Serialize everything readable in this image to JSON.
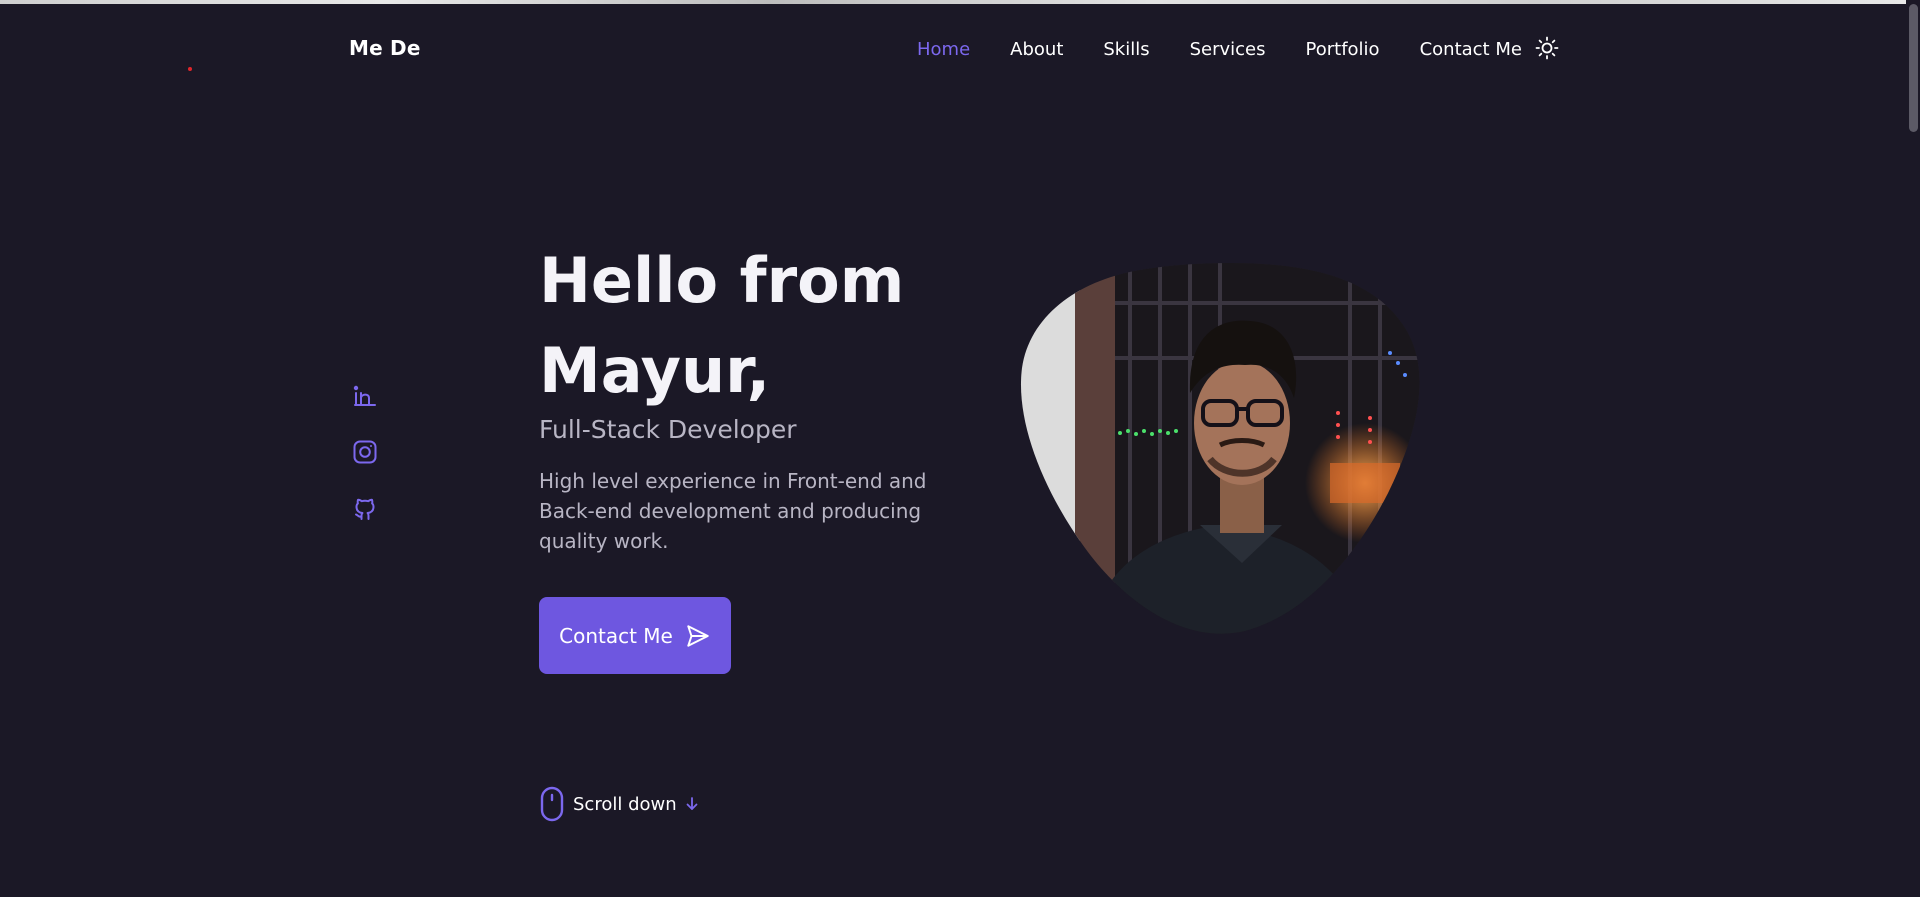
{
  "header": {
    "logo": "Me De",
    "nav": [
      {
        "label": "Home",
        "active": true
      },
      {
        "label": "About",
        "active": false
      },
      {
        "label": "Skills",
        "active": false
      },
      {
        "label": "Services",
        "active": false
      },
      {
        "label": "Portfolio",
        "active": false
      },
      {
        "label": "Contact Me",
        "active": false
      }
    ],
    "theme_toggle_icon": "sun-icon"
  },
  "socials": [
    {
      "icon": "linkedin-icon"
    },
    {
      "icon": "instagram-icon"
    },
    {
      "icon": "github-icon"
    }
  ],
  "hero": {
    "title_line1": "Hello from",
    "title_line2": "Mayur,",
    "subtitle": "Full-Stack Developer",
    "description": "High level experience in Front-end and Back-end development and producing quality work.",
    "cta_label": "Contact Me",
    "cta_icon": "send-icon"
  },
  "scroll": {
    "label": "Scroll down",
    "icon": "mouse-icon",
    "arrow_icon": "arrow-down-icon"
  },
  "colors": {
    "background": "#1b1826",
    "accent": "#6e57e0",
    "accent_text": "#7c68ee",
    "muted_text": "#b8b5c4"
  }
}
